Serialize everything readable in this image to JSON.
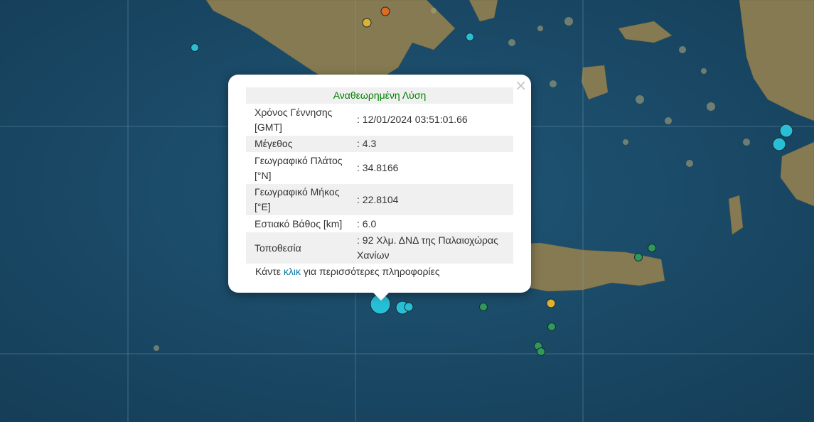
{
  "popup": {
    "title": "Αναθεωρημένη Λύση",
    "close_icon": "×",
    "rows": [
      {
        "label": "Χρόνος Γέννησης [GMT]",
        "value": ": 12/01/2024 03:51:01.66"
      },
      {
        "label": "Μέγεθος",
        "value": ": 4.3"
      },
      {
        "label": "Γεωγραφικό Πλάτος [°N]",
        "value": ": 34.8166"
      },
      {
        "label": "Γεωγραφικό Μήκος [°E]",
        "value": ": 22.8104"
      },
      {
        "label": "Εστιακό Βάθος [km]",
        "value": ": 6.0"
      },
      {
        "label": "Τοποθεσία",
        "value": ": 92 Χλμ. ΔΝΔ της Παλαιοχώρας Χανίων"
      }
    ],
    "footer_before": "Κάντε ",
    "footer_link": "κλικ",
    "footer_after": " για περισσότερες πληροφορίες"
  },
  "colors": {
    "sea": "#1b4a66",
    "land": "#8a7d55",
    "title_green": "#008000",
    "link_blue": "#0078a8",
    "cyan_marker": "#27bfd6",
    "green_marker": "#2e9a5a",
    "yellow_marker": "#e0b030",
    "orange_marker": "#e06a20"
  }
}
